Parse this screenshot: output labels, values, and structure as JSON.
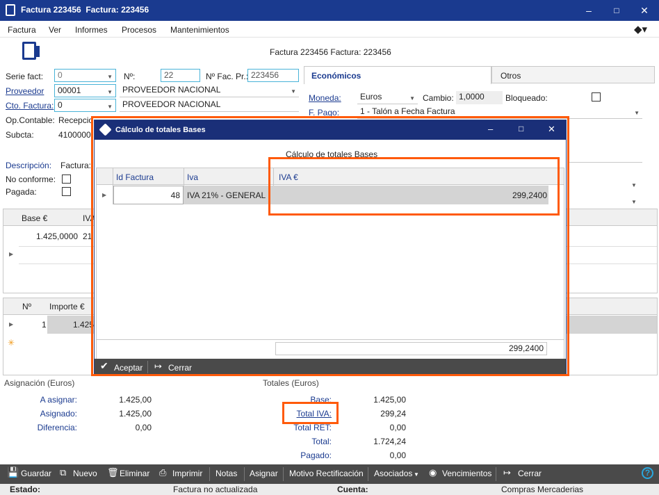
{
  "window": {
    "title": "Factura 223456  Factura: 223456"
  },
  "menu": [
    "Factura",
    "Ver",
    "Informes",
    "Procesos",
    "Mantenimientos"
  ],
  "header": {
    "title": "Factura 223456  Factura: 223456"
  },
  "form": {
    "serie_label": "Serie fact:",
    "serie_value": "0",
    "num_label": "Nº:",
    "num_value": "22",
    "numfacpr_label": "Nº Fac. Pr.:",
    "numfacpr_value": "223456",
    "proveedor_label": "Proveedor",
    "proveedor_value": "00001",
    "proveedor_name": "PROVEEDOR NACIONAL",
    "cto_label": "Cto. Factura:",
    "cto_value": "0",
    "cto_name": "PROVEEDOR NACIONAL",
    "opcontable_label": "Op.Contable:",
    "opcontable_value": "Recepcio",
    "subcta_label": "Subcta:",
    "subcta_value": "4100000",
    "descripcion_label": "Descripción:",
    "descripcion_value": "Factura:",
    "noconforme_label": "No conforme:",
    "pagada_label": "Pagada:"
  },
  "tabs": {
    "economicos": "Económicos",
    "otros": "Otros"
  },
  "economicos": {
    "moneda_label": "Moneda:",
    "moneda_value": "Euros",
    "cambio_label": "Cambio:",
    "cambio_value": "1,0000",
    "bloqueado_label": "Bloqueado:",
    "fpago_label": "F. Pago:",
    "fpago_value": "1 - Talón a Fecha Factura"
  },
  "bases_grid": {
    "col1": "Base €",
    "col2": "IVA",
    "row_base": "1.425,0000",
    "row_iva": "21"
  },
  "vto_grid": {
    "col1": "Nº",
    "col2": "Importe €",
    "row_num": "1",
    "row_importe": "1.425"
  },
  "asignacion": {
    "title": "Asignación (Euros)",
    "a_asignar_label": "A asignar:",
    "a_asignar": "1.425,00",
    "asignado_label": "Asignado:",
    "asignado": "1.425,00",
    "diferencia_label": "Diferencia:",
    "diferencia": "0,00"
  },
  "totales": {
    "title": "Totales (Euros)",
    "base_label": "Base:",
    "base": "1.425,00",
    "total_iva_label": "Total IVA:",
    "total_iva": "299,24",
    "total_ret_label": "Total RET:",
    "total_ret": "0,00",
    "total_label": "Total:",
    "total": "1.724,24",
    "pagado_label": "Pagado:",
    "pagado": "0,00"
  },
  "toolbar": [
    "Guardar",
    "Nuevo",
    "Eliminar",
    "Imprimir",
    "Notas",
    "Asignar",
    "Motivo Rectificación",
    "Asociados",
    "Vencimientos",
    "Cerrar"
  ],
  "status": {
    "estado_label": "Estado:",
    "estado_value": "Factura no actualizada",
    "cuenta_label": "Cuenta:",
    "cuenta_value": "Compras Mercaderias"
  },
  "dialog": {
    "title": "Cálculo de totales Bases",
    "subtitle": "Cálculo de totales Bases",
    "columns": [
      "Id Factura",
      "Iva",
      "IVA €"
    ],
    "row": {
      "id": "48",
      "iva": "IVA 21% - GENERAL",
      "iva_eur": "299,2400"
    },
    "footer_total": "299,2400",
    "accept": "Aceptar",
    "close": "Cerrar"
  },
  "colors": {
    "titlebar": "#1a3a8f",
    "highlight": "#ff5a0a",
    "toolbar": "#4a4a4a"
  }
}
